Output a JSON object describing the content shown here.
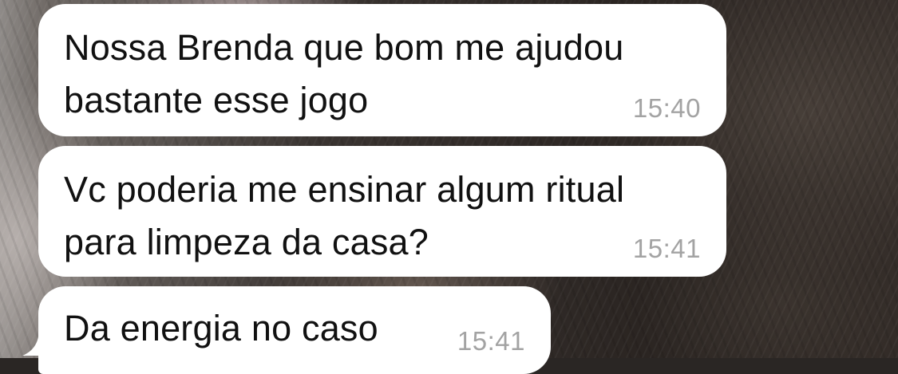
{
  "chat": {
    "messages": [
      {
        "text": "Nossa Brenda que bom me ajudou\nbastante esse jogo",
        "time": "15:40"
      },
      {
        "text": "Vc poderia me ensinar algum ritual\npara limpeza da casa?",
        "time": "15:41"
      },
      {
        "text": "Da energia no caso",
        "time": "15:41"
      }
    ]
  },
  "colors": {
    "bubble": "#ffffff",
    "text": "#111111",
    "timestamp": "#a3a3a3"
  }
}
